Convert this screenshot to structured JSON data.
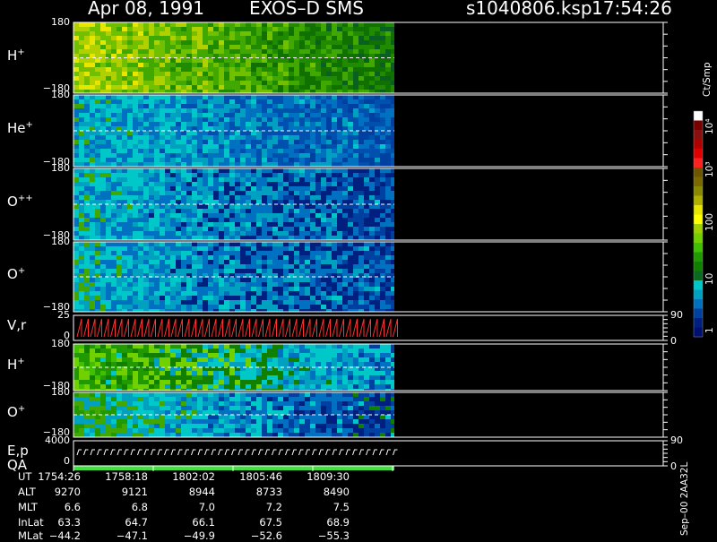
{
  "header": {
    "date": "Apr 08, 1991",
    "instrument": "EXOS–D SMS",
    "file": "s1040806.ksp",
    "time": "17:54:26"
  },
  "panels": [
    {
      "label": "H",
      "sup": "+",
      "top": "180",
      "bottom": "−180"
    },
    {
      "label": "He",
      "sup": "+",
      "top": "180",
      "bottom": "−180"
    },
    {
      "label": "O",
      "sup": "++",
      "top": "180",
      "bottom": "−180"
    },
    {
      "label": "O",
      "sup": "+",
      "top": "180",
      "bottom": "−180"
    },
    {
      "label": "V,r",
      "sup": "",
      "top": "25",
      "bottom": "0",
      "right_top": "90",
      "right_bottom": "0"
    },
    {
      "label": "H",
      "sup": "+",
      "top": "180",
      "bottom": "−180"
    },
    {
      "label": "O",
      "sup": "+",
      "top": "180",
      "bottom": "−180"
    },
    {
      "label": "E,p",
      "sup": "",
      "label2": "QA",
      "top": "4000",
      "bottom": "0",
      "right_top": "90",
      "right_bottom": "0"
    }
  ],
  "colorbar": {
    "unit": "Ct/Smp",
    "labels": [
      "10⁴",
      "10³",
      "100",
      "10",
      "1"
    ],
    "colors": [
      "#ffffff",
      "#7a0000",
      "#8a1010",
      "#b00000",
      "#e00000",
      "#ff2020",
      "#6e5500",
      "#7a6a00",
      "#8a8a00",
      "#b0b000",
      "#e6e600",
      "#ffff00",
      "#a0d000",
      "#70d000",
      "#40c000",
      "#209a00",
      "#108000",
      "#0a6a20",
      "#00c8c8",
      "#00a0c0",
      "#0070c0",
      "#0040a0",
      "#002080",
      "#001070"
    ]
  },
  "ephemeris": {
    "labels": [
      "UT",
      "ALT",
      "MLT",
      "InLat",
      "MLat"
    ],
    "columns": [
      [
        "1754:26",
        "9270",
        "6.6",
        "63.3",
        "−44.2"
      ],
      [
        "1758:18",
        "9121",
        "6.8",
        "64.7",
        "−47.1"
      ],
      [
        "1802:02",
        "8944",
        "7.0",
        "66.1",
        "−49.9"
      ],
      [
        "1805:46",
        "8733",
        "7.2",
        "67.5",
        "−52.6"
      ],
      [
        "1809:30",
        "8490",
        "7.5",
        "68.9",
        "−55.3"
      ]
    ]
  },
  "footer_code": "Sep–00 2AA32L",
  "chart_data": {
    "type": "heatmap",
    "title": "Apr 08, 1991    EXOS–D SMS",
    "x_ticks": [
      "1754:26",
      "1758:18",
      "1802:02",
      "1805:46",
      "1809:30"
    ],
    "color_scale": "log",
    "color_range": [
      1,
      10000
    ],
    "color_unit": "Ct/Smp",
    "series": [
      {
        "name": "H+",
        "ylim": [
          -180,
          180
        ]
      },
      {
        "name": "He+",
        "ylim": [
          -180,
          180
        ]
      },
      {
        "name": "O++",
        "ylim": [
          -180,
          180
        ]
      },
      {
        "name": "O+",
        "ylim": [
          -180,
          180
        ]
      },
      {
        "name": "V,r",
        "ylim": [
          0,
          25
        ],
        "y2lim": [
          0,
          90
        ]
      },
      {
        "name": "H+",
        "ylim": [
          -180,
          180
        ]
      },
      {
        "name": "O+",
        "ylim": [
          -180,
          180
        ]
      },
      {
        "name": "E,p",
        "ylim": [
          0,
          4000
        ],
        "y2lim": [
          0,
          90
        ]
      }
    ]
  }
}
